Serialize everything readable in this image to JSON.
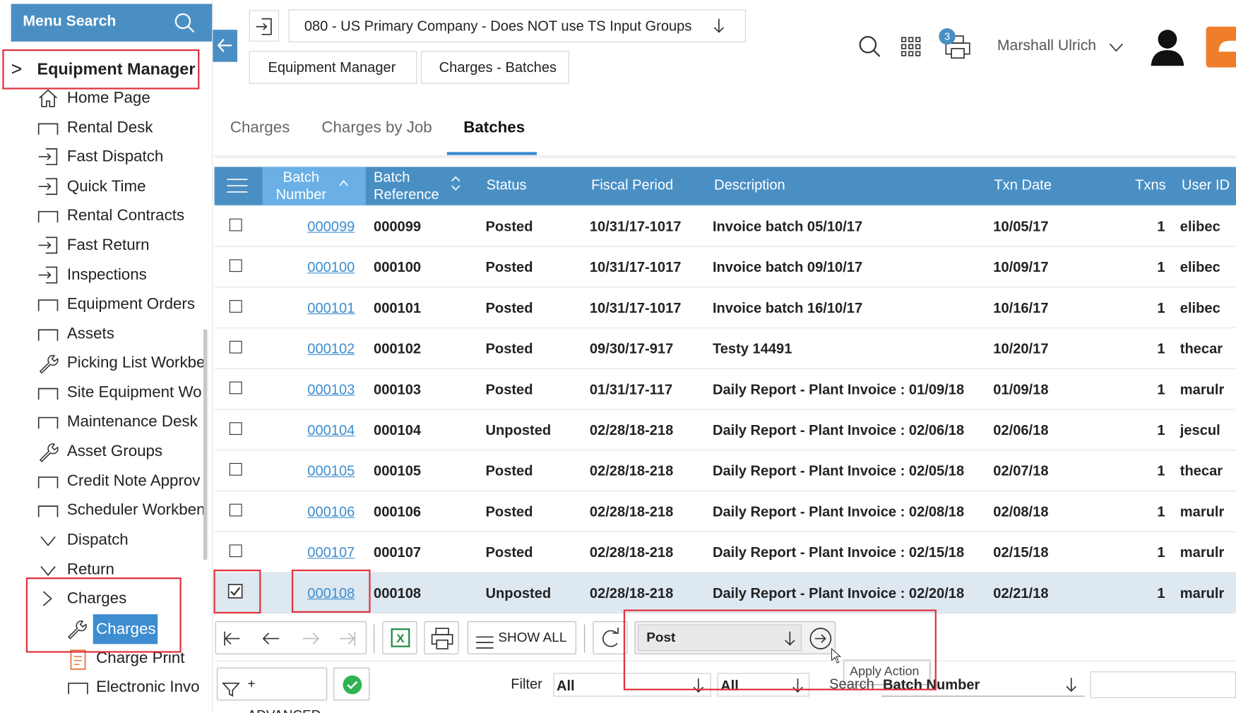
{
  "sidebar": {
    "search_label": "Menu Search",
    "header": "Equipment Manager",
    "items": [
      {
        "label": "Home Page",
        "icon": "home-icon"
      },
      {
        "label": "Rental Desk",
        "icon": "folder-icon"
      },
      {
        "label": "Fast Dispatch",
        "icon": "login-icon"
      },
      {
        "label": "Quick Time",
        "icon": "login-icon"
      },
      {
        "label": "Rental Contracts",
        "icon": "folder-icon"
      },
      {
        "label": "Fast Return",
        "icon": "login-icon"
      },
      {
        "label": "Inspections",
        "icon": "login-icon"
      },
      {
        "label": "Equipment Orders",
        "icon": "folder-icon"
      },
      {
        "label": "Assets",
        "icon": "folder-icon"
      },
      {
        "label": "Picking List Workbe",
        "icon": "wrench-icon"
      },
      {
        "label": "Site Equipment Wo",
        "icon": "folder-icon"
      },
      {
        "label": "Maintenance Desk",
        "icon": "folder-icon"
      },
      {
        "label": "Asset Groups",
        "icon": "wrench-icon"
      },
      {
        "label": "Credit Note Approv",
        "icon": "folder-icon"
      },
      {
        "label": "Scheduler Workben",
        "icon": "folder-icon"
      }
    ],
    "groups": [
      {
        "label": "Dispatch"
      },
      {
        "label": "Return"
      },
      {
        "label": "Charges"
      }
    ],
    "sub_items": [
      {
        "label": "Charges"
      },
      {
        "label": "Charge Print"
      },
      {
        "label": "Electronic Invo"
      }
    ]
  },
  "header": {
    "company": "080 - US Primary Company - Does NOT use TS Input Groups",
    "crumbs": [
      "Equipment Manager",
      "Charges - Batches"
    ],
    "badge_count": "3",
    "user_name": "Marshall Ulrich"
  },
  "tabs": [
    "Charges",
    "Charges by Job",
    "Batches"
  ],
  "active_tab": "Batches",
  "columns": {
    "batch_number": "Batch Number",
    "batch_number_l1": "Batch",
    "batch_number_l2": "Number",
    "batch_reference_l1": "Batch",
    "batch_reference_l2": "Reference",
    "status": "Status",
    "fiscal_period": "Fiscal Period",
    "description": "Description",
    "txn_date": "Txn Date",
    "txns": "Txns",
    "user_id": "User ID"
  },
  "rows": [
    {
      "batch": "000099",
      "ref": "000099",
      "status": "Posted",
      "period": "10/31/17-1017",
      "desc": "Invoice batch 05/10/17",
      "date": "10/05/17",
      "txns": "1",
      "user": "elibec",
      "checked": false
    },
    {
      "batch": "000100",
      "ref": "000100",
      "status": "Posted",
      "period": "10/31/17-1017",
      "desc": "Invoice batch 09/10/17",
      "date": "10/09/17",
      "txns": "1",
      "user": "elibec",
      "checked": false
    },
    {
      "batch": "000101",
      "ref": "000101",
      "status": "Posted",
      "period": "10/31/17-1017",
      "desc": "Invoice batch 16/10/17",
      "date": "10/16/17",
      "txns": "1",
      "user": "elibec",
      "checked": false
    },
    {
      "batch": "000102",
      "ref": "000102",
      "status": "Posted",
      "period": "09/30/17-917",
      "desc": "Testy 14491",
      "date": "10/20/17",
      "txns": "1",
      "user": "thecar",
      "checked": false
    },
    {
      "batch": "000103",
      "ref": "000103",
      "status": "Posted",
      "period": "01/31/17-117",
      "desc": "Daily Report - Plant Invoice : 01/09/18",
      "date": "01/09/18",
      "txns": "1",
      "user": "marulr",
      "checked": false
    },
    {
      "batch": "000104",
      "ref": "000104",
      "status": "Unposted",
      "period": "02/28/18-218",
      "desc": "Daily Report - Plant Invoice : 02/06/18",
      "date": "02/06/18",
      "txns": "1",
      "user": "jescul",
      "checked": false
    },
    {
      "batch": "000105",
      "ref": "000105",
      "status": "Posted",
      "period": "02/28/18-218",
      "desc": "Daily Report - Plant Invoice : 02/05/18",
      "date": "02/07/18",
      "txns": "1",
      "user": "thecar",
      "checked": false
    },
    {
      "batch": "000106",
      "ref": "000106",
      "status": "Posted",
      "period": "02/28/18-218",
      "desc": "Daily Report - Plant Invoice : 02/08/18",
      "date": "02/08/18",
      "txns": "1",
      "user": "marulr",
      "checked": false
    },
    {
      "batch": "000107",
      "ref": "000107",
      "status": "Posted",
      "period": "02/28/18-218",
      "desc": "Daily Report - Plant Invoice : 02/15/18",
      "date": "02/15/18",
      "txns": "1",
      "user": "marulr",
      "checked": false
    },
    {
      "batch": "000108",
      "ref": "000108",
      "status": "Unposted",
      "period": "02/28/18-218",
      "desc": "Daily Report - Plant Invoice : 02/20/18",
      "date": "02/21/18",
      "txns": "1",
      "user": "marulr",
      "checked": true
    }
  ],
  "toolbar": {
    "show_all": "SHOW ALL",
    "action_value": "Post",
    "apply_tooltip": "Apply Action",
    "advanced": "+ ADVANCED"
  },
  "filter": {
    "label": "Filter",
    "value1": "All",
    "value2": "All",
    "search_label": "Search",
    "search_field": "Batch Number"
  },
  "colors": {
    "accent": "#4a8fc4",
    "highlight": "#e0323c",
    "selected_row": "#dde8f1",
    "orange": "#f07d2a"
  }
}
